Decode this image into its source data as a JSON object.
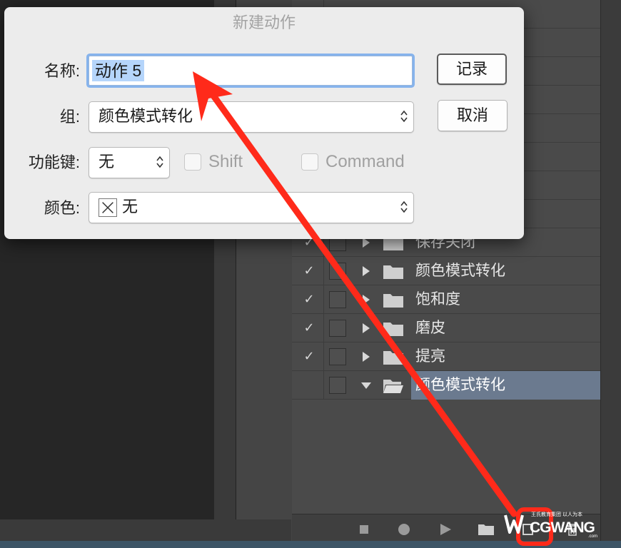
{
  "dialog": {
    "title": "新建动作",
    "name_label": "名称:",
    "name_value": "动作 5",
    "group_label": "组:",
    "group_value": "颜色模式转化",
    "function_key_label": "功能键:",
    "function_key_value": "无",
    "shift_label": "Shift",
    "command_label": "Command",
    "color_label": "颜色:",
    "color_value": "无",
    "record_button": "记录",
    "cancel_button": "取消"
  },
  "actions_panel": {
    "rows": [
      {
        "label": "保存关闭",
        "checked": true,
        "state": "collapsed",
        "selected": false
      },
      {
        "label": "颜色模式转化",
        "checked": true,
        "state": "collapsed",
        "selected": false
      },
      {
        "label": "饱和度",
        "checked": true,
        "state": "collapsed",
        "selected": false
      },
      {
        "label": "磨皮",
        "checked": true,
        "state": "collapsed",
        "selected": false
      },
      {
        "label": "提亮",
        "checked": true,
        "state": "collapsed",
        "selected": false
      },
      {
        "label": "颜色模式转化",
        "checked": false,
        "state": "expanded",
        "selected": true
      }
    ],
    "check_glyph": "✓",
    "selection_color": "#6b7a8f"
  },
  "bottom_toolbar": {
    "icons": [
      "stop-icon",
      "record-icon",
      "play-icon",
      "folder-icon",
      "new-action-icon",
      "trash-icon"
    ]
  },
  "annotation": {
    "arrow_color": "#ff2a1a"
  },
  "watermark": {
    "brand": "CGWANG",
    "tagline": "王氏教育集团 以人为本",
    "domain": ".com"
  }
}
